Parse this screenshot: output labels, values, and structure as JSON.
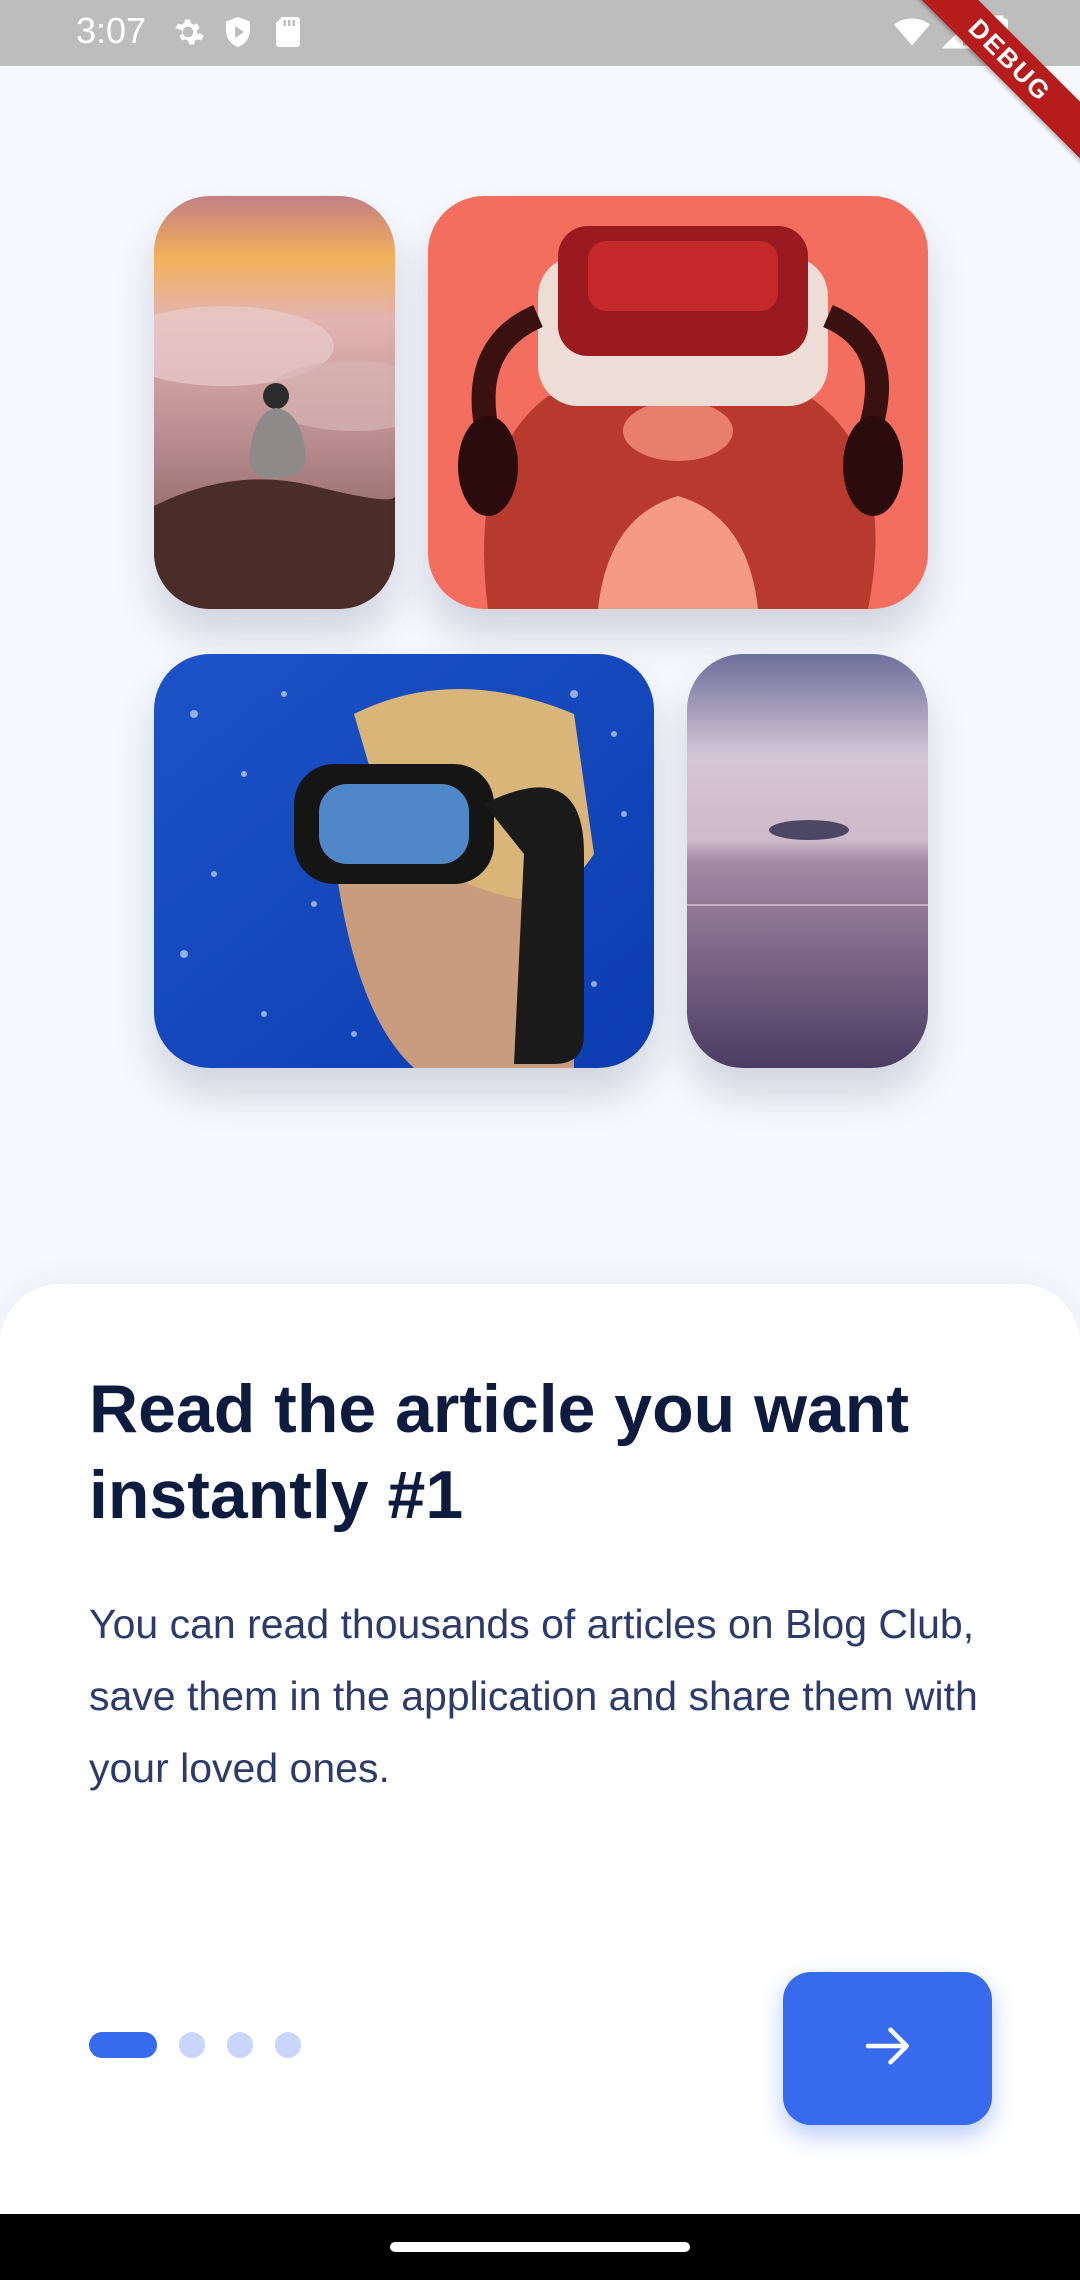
{
  "status_bar": {
    "time": "3:07",
    "left_icons": [
      "gear-icon",
      "shield-play-icon",
      "sd-card-icon"
    ],
    "right_icons": [
      "wifi-icon",
      "cell-signal-icon",
      "battery-icon"
    ]
  },
  "debug_banner": "DEBUG",
  "gallery": {
    "images": [
      "person-on-mountain-clouds-photo",
      "vr-headset-photo",
      "snorkel-diver-photo",
      "ocean-horizon-photo"
    ]
  },
  "onboarding": {
    "title": "Read the article you want instantly #1",
    "description": "You can read thousands of articles on Blog Club, save them in the application and share them with your loved ones.",
    "page_indicator": {
      "current": 1,
      "total": 4
    },
    "next_button_icon": "arrow-right-icon"
  },
  "colors": {
    "accent": "#376aed",
    "title": "#0d1b3e",
    "body": "#2e3a6b",
    "dot_inactive": "#c9d6fb"
  }
}
